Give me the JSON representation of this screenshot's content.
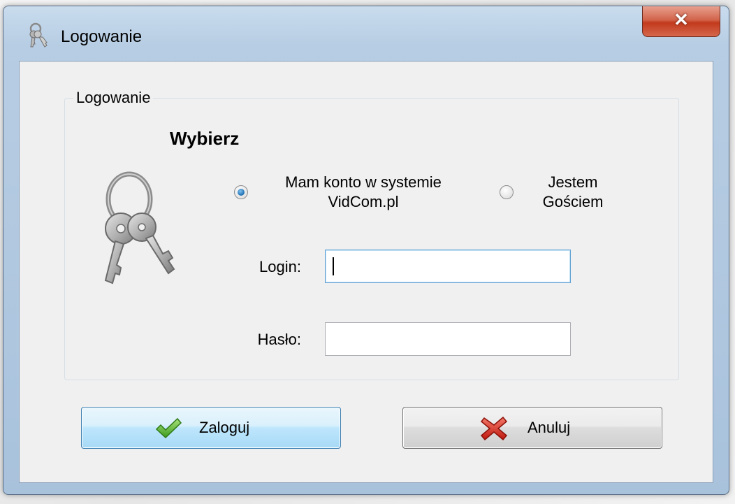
{
  "window": {
    "title": "Logowanie",
    "close_label": "✕"
  },
  "group": {
    "legend": "Logowanie",
    "heading": "Wybierz"
  },
  "account_options": [
    {
      "label_line1": "Mam konto w systemie",
      "label_line2": "VidCom.pl",
      "selected": true
    },
    {
      "label_line1": "Jestem",
      "label_line2": "Gościem",
      "selected": false
    }
  ],
  "fields": {
    "login_label": "Login:",
    "login_value": "",
    "password_label": "Hasło:",
    "password_value": ""
  },
  "buttons": {
    "login_label": "Zaloguj",
    "cancel_label": "Anuluj"
  },
  "icons": {
    "title": "keys-icon",
    "group": "keys-icon",
    "login_button": "checkmark-icon",
    "cancel_button": "red-x-icon"
  },
  "colors": {
    "titlebar": "#b7cde3",
    "close_button": "#c23a1d",
    "radio_selected": "#2a78b8",
    "focused_border": "#5fa1d6",
    "checkmark": "#5cb32e",
    "cancel_x": "#d42a1f"
  }
}
